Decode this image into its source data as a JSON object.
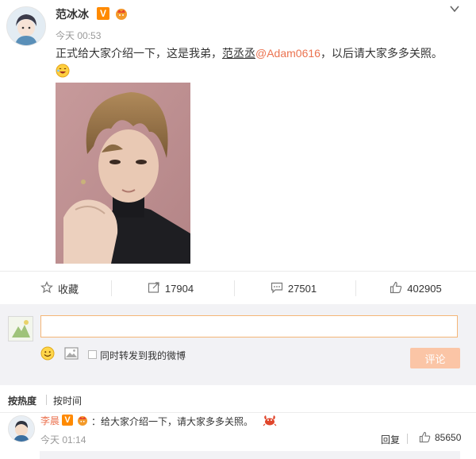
{
  "post": {
    "author": "范冰冰",
    "verified_badge": "V",
    "time": "今天 00:53",
    "text_before": "正式给大家介绍一下，这是我弟，",
    "brother_name": "范丞丞",
    "mention": "@Adam0616",
    "text_after": "，以后请大家多多关照。"
  },
  "actions": {
    "favorite_label": "收藏",
    "repost_count": "17904",
    "comment_count": "27501",
    "like_count": "402905"
  },
  "composer": {
    "input_value": "",
    "also_repost_label": "同时转发到我的微博",
    "submit_label": "评论"
  },
  "sort": {
    "by_hot": "按热度",
    "by_time": "按时间"
  },
  "comments": [
    {
      "author": "李晨",
      "verified_badge": "V",
      "text": "：给大家介绍一下，请大家多多关照。",
      "time": "今天 01:14",
      "reply_label": "回复",
      "likes": "85650"
    }
  ],
  "colors": {
    "accent": "#eb7350",
    "input_border": "#f4b677",
    "submit_disabled": "#fbc5a6",
    "verified": "#ff8a00",
    "panel_bg": "#f2f2f5"
  }
}
